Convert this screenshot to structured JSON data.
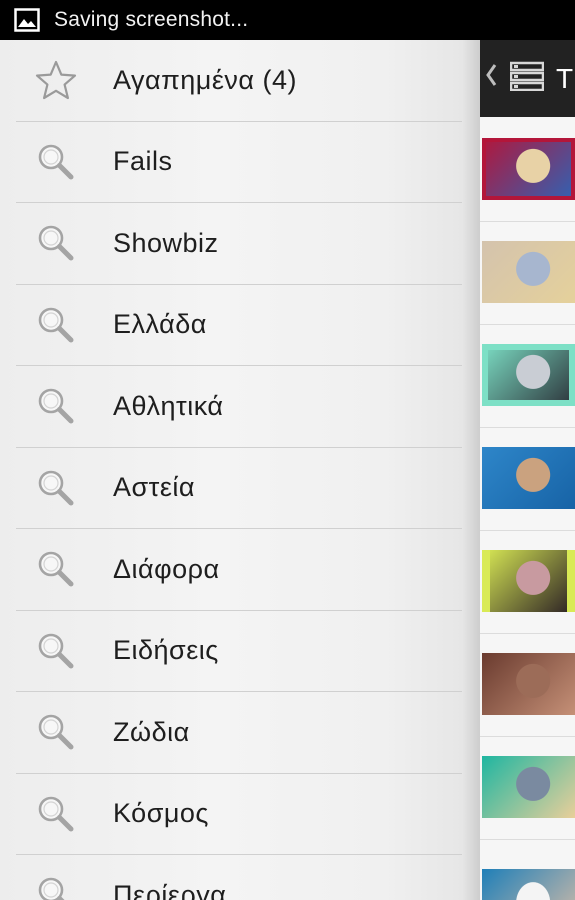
{
  "status_bar": {
    "text": "Saving screenshot...",
    "icon": "image-icon"
  },
  "drawer": {
    "items": [
      {
        "label": "Αγαπημένα (4)",
        "icon": "star-icon"
      },
      {
        "label": "Fails",
        "icon": "search-icon"
      },
      {
        "label": "Showbiz",
        "icon": "search-icon"
      },
      {
        "label": "Ελλάδα",
        "icon": "search-icon"
      },
      {
        "label": "Αθλητικά",
        "icon": "search-icon"
      },
      {
        "label": "Αστεία",
        "icon": "search-icon"
      },
      {
        "label": "Διάφορα",
        "icon": "search-icon"
      },
      {
        "label": "Ειδήσεις",
        "icon": "search-icon"
      },
      {
        "label": "Ζώδια",
        "icon": "search-icon"
      },
      {
        "label": "Κόσμος",
        "icon": "search-icon"
      },
      {
        "label": "Περίεργα",
        "icon": "search-icon"
      }
    ]
  },
  "content": {
    "actionbar": {
      "back_icon": "chevron-left-icon",
      "list_icon": "list-icon",
      "title": "T"
    },
    "thumbnails": [
      {
        "name": "news-studio-thumbnail",
        "colors": [
          "#b3163a",
          "#2f63b5",
          "#e8d2a6"
        ]
      },
      {
        "name": "blonde-portrait-thumbnail",
        "colors": [
          "#d4c3ad",
          "#e5d19b",
          "#a7b6cf"
        ]
      },
      {
        "name": "office-video-thumbnail",
        "colors": [
          "#7de0c6",
          "#2b3138",
          "#c9cdd4"
        ]
      },
      {
        "name": "beach-sea-thumbnail",
        "colors": [
          "#2e86c9",
          "#1763a6",
          "#caa27f"
        ]
      },
      {
        "name": "selfie-portrait-thumbnail",
        "colors": [
          "#d9ea55",
          "#2a1f24",
          "#c89aa0"
        ]
      },
      {
        "name": "sunbathing-thumbnail",
        "colors": [
          "#6a3b2f",
          "#c59077",
          "#9c6c58"
        ]
      },
      {
        "name": "blonde-closeup-thumbnail",
        "colors": [
          "#1fb6a1",
          "#e9cf9a",
          "#7a8aa0"
        ]
      },
      {
        "name": "bikini-thumbnail",
        "colors": [
          "#1f7fb8",
          "#e6c2a6",
          "#f4f4f4"
        ]
      }
    ]
  }
}
